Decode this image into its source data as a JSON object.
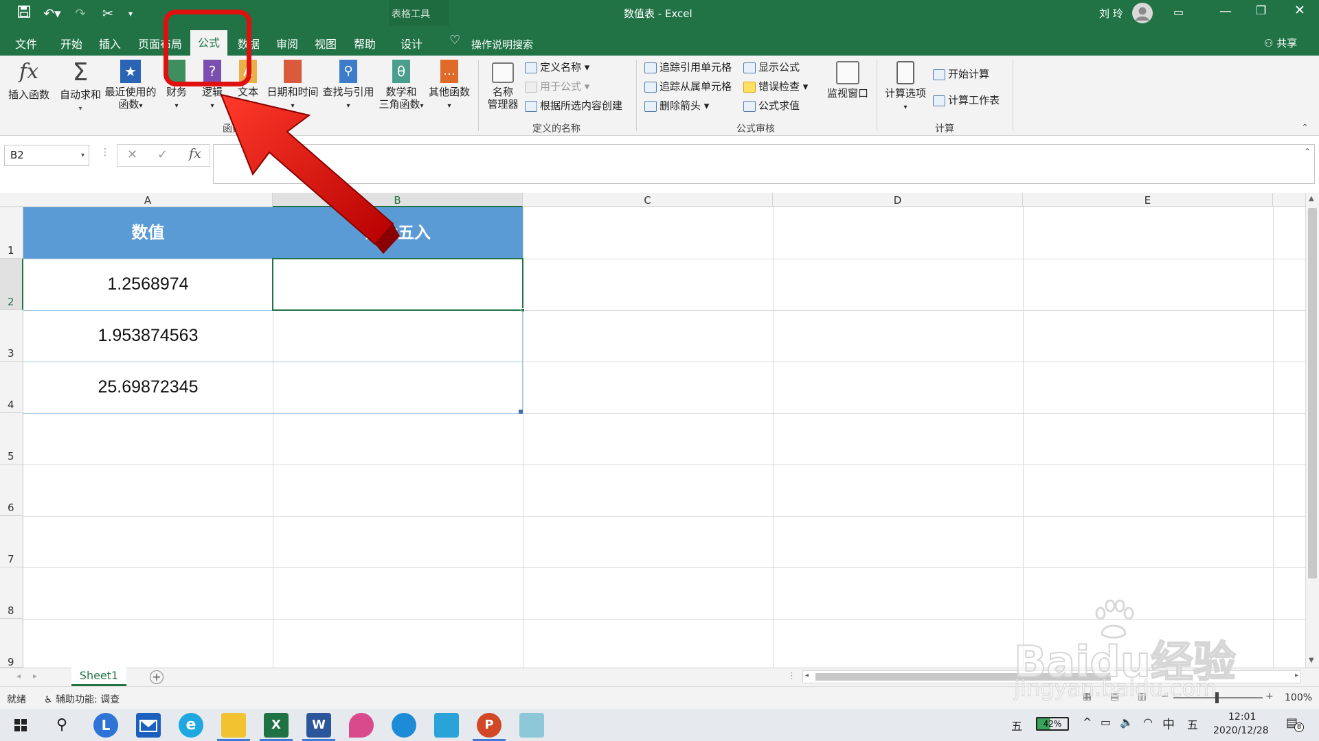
{
  "window": {
    "title": "数值表 - Excel",
    "context_tools": "表格工具",
    "user": "刘 玲"
  },
  "tabs": [
    "文件",
    "开始",
    "插入",
    "页面布局",
    "公式",
    "数据",
    "审阅",
    "视图",
    "帮助",
    "设计"
  ],
  "active_tab": "公式",
  "tell_me": "操作说明搜索",
  "share": "共享",
  "ribbon": {
    "function_library": {
      "insert_function": "插入函数",
      "autosum": "自动求和",
      "recent_1": "最近使用的",
      "recent_2": "函数",
      "financial": "财务",
      "logical": "逻辑",
      "text": "文本",
      "datetime": "日期和时间",
      "lookup": "查找与引用",
      "math_1": "数学和",
      "math_2": "三角函数",
      "more": "其他函数",
      "group_label": "函数库"
    },
    "defined_names": {
      "name_manager_1": "名称",
      "name_manager_2": "管理器",
      "define_name": "定义名称",
      "use_in_formula": "用于公式",
      "create_from_selection": "根据所选内容创建",
      "group_label": "定义的名称"
    },
    "formula_auditing": {
      "trace_precedents": "追踪引用单元格",
      "trace_dependents": "追踪从属单元格",
      "remove_arrows": "删除箭头",
      "show_formulas": "显示公式",
      "error_checking": "错误检查",
      "evaluate_formula": "公式求值",
      "watch_window": "监视窗口",
      "group_label": "公式审核"
    },
    "calculation": {
      "options": "计算选项",
      "calc_now": "开始计算",
      "calc_sheet": "计算工作表",
      "group_label": "计算"
    }
  },
  "formula_bar": {
    "name_box": "B2",
    "fx": "fx",
    "content": ""
  },
  "columns": [
    "A",
    "B",
    "C",
    "D",
    "E"
  ],
  "rows": [
    "1",
    "2",
    "3",
    "4",
    "5",
    "6",
    "7",
    "8",
    "9"
  ],
  "cells": {
    "A1": "数值",
    "B1": "四舍五入",
    "A2": "1.2568974",
    "A3": "1.953874563",
    "A4": "25.69872345"
  },
  "sheet_tab": "Sheet1",
  "status": {
    "ready": "就绪",
    "accessibility": "辅助功能: 调查",
    "zoom": "100%"
  },
  "taskbar": {
    "battery": "42%",
    "ime": "中",
    "ime2": "五",
    "time": "12:01",
    "date": "2020/12/28",
    "notifications": "8"
  },
  "watermark": {
    "brand": "Baidu经验",
    "url": "jingyan.baidu.com"
  },
  "colors": {
    "excel_green": "#217346",
    "header_fill": "#5b9bd5",
    "annotation_red": "#e01010"
  }
}
